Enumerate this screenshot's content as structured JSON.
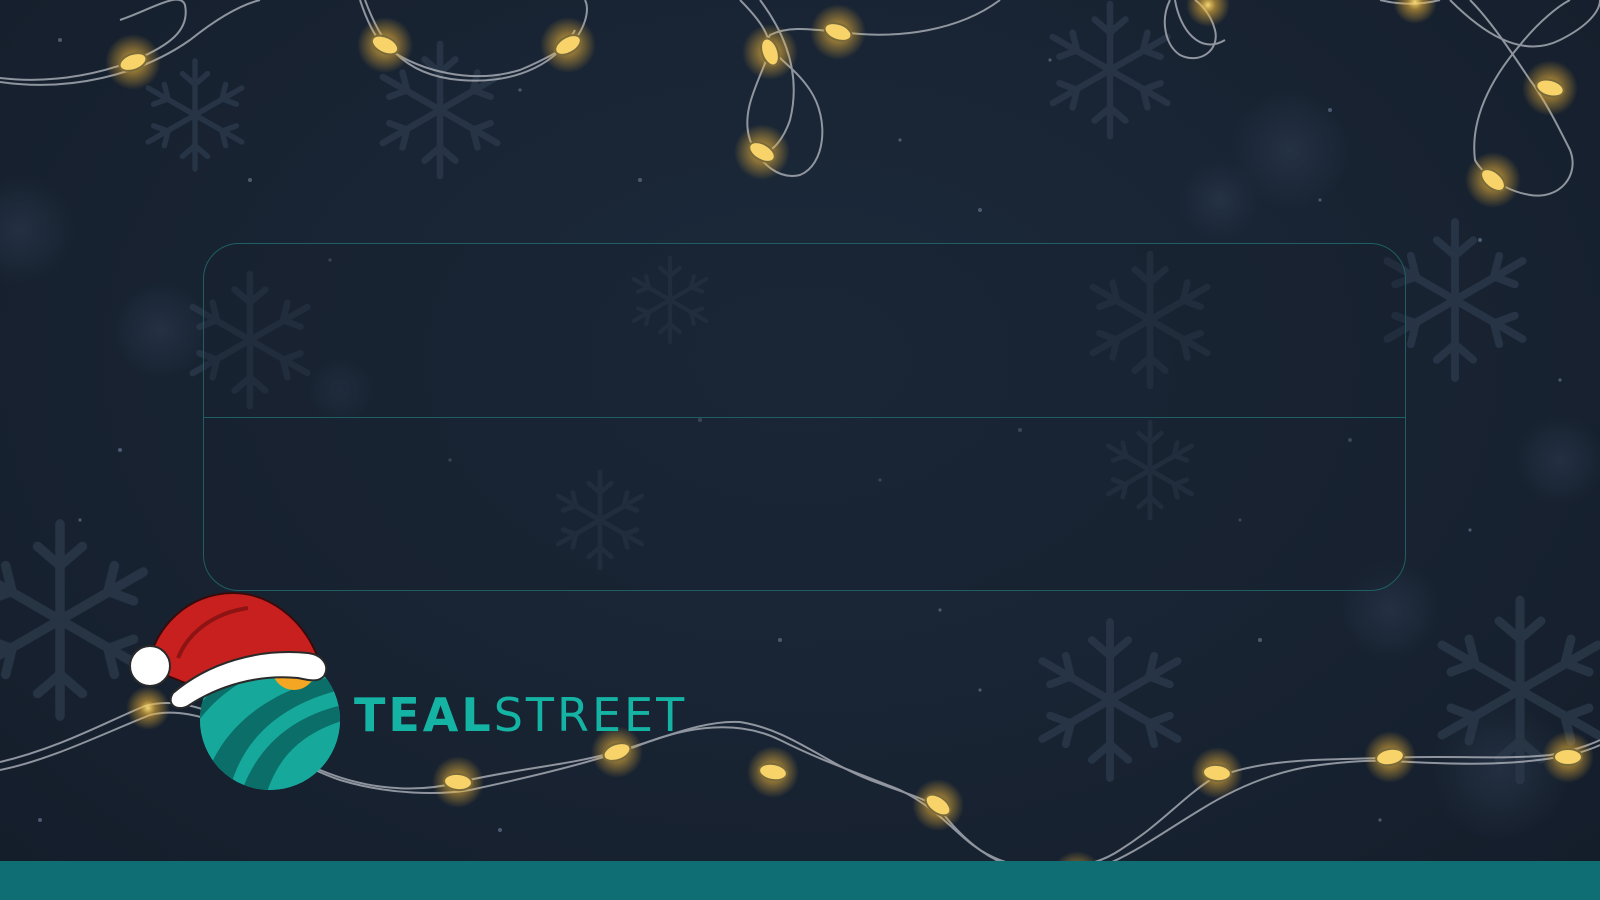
{
  "brand": {
    "part1": "TEAL",
    "part2": "STREET",
    "logo_icon": "tealstreet-globe-santa-hat-icon"
  },
  "theme": {
    "background": "#182332",
    "accent": "#14b3a4",
    "panel_border": "#1f5f63",
    "footer": "#0e6e73",
    "light_glow": "#f5c542"
  },
  "decorations": {
    "lights": "string-lights-icon",
    "snowflakes": "snowflake-icon"
  }
}
